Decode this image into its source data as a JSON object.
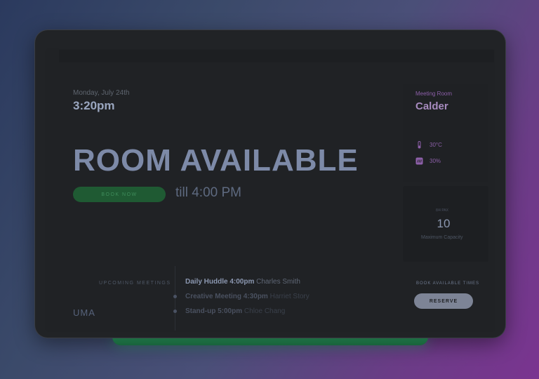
{
  "header": {
    "date": "Monday, July 24th",
    "time": "3:20pm"
  },
  "main": {
    "status": "ROOM AVAILABLE",
    "book_label": "BOOK NOW",
    "until": "till 4:00 PM"
  },
  "room": {
    "label": "Meeting Room",
    "name": "Calder",
    "temperature": "30°C",
    "humidity": "30%",
    "capacity_small": "8/4 PAX",
    "capacity": "10",
    "capacity_label": "Maximum Capacity"
  },
  "upcoming": {
    "label": "UPCOMING MEETINGS",
    "meetings": [
      {
        "title": "Daily Huddle 4:00pm",
        "host": "Charles Smith"
      },
      {
        "title": "Creative Meeting 4:30pm",
        "host": "Harriet Story"
      },
      {
        "title": "Stand-up 5:00pm",
        "host": "Chloe Chang"
      }
    ]
  },
  "logo": "UMA",
  "booking": {
    "label": "BOOK AVAILABLE TIMES",
    "reserve_label": "RESERVE"
  },
  "colors": {
    "accent_green": "#1f5a33",
    "accent_purple": "#8c5fa8",
    "panel": "#202225"
  }
}
